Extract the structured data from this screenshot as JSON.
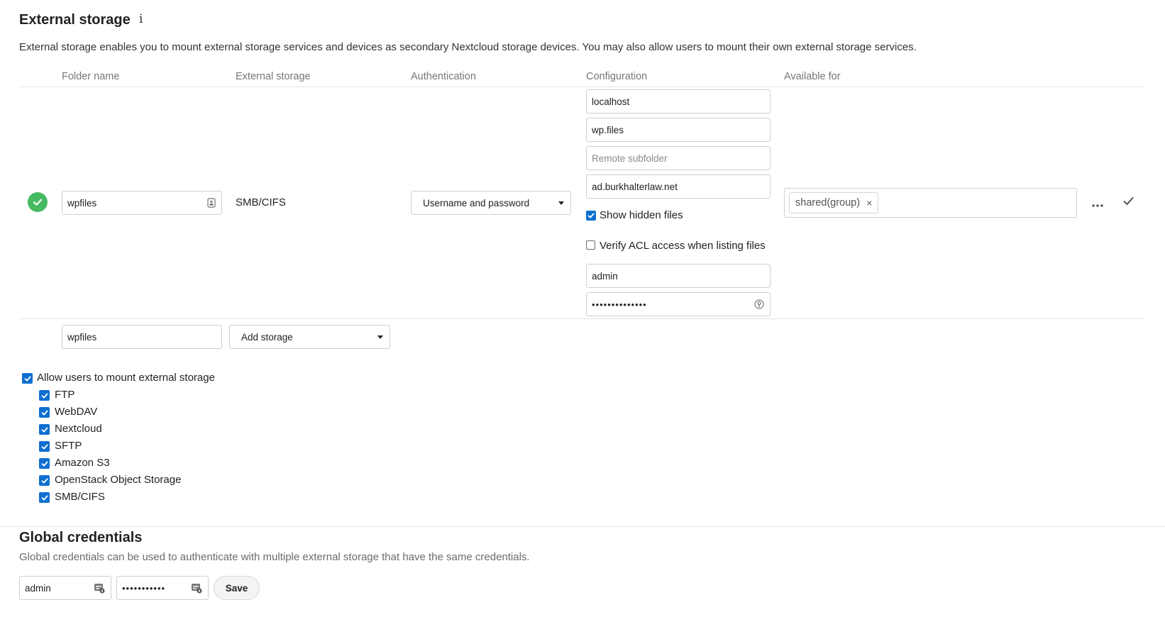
{
  "external_storage": {
    "title": "External storage",
    "info_glyph": "i",
    "description": "External storage enables you to mount external storage services and devices as secondary Nextcloud storage devices. You may also allow users to mount their own external storage services.",
    "columns": {
      "folder_name": "Folder name",
      "external_storage": "External storage",
      "authentication": "Authentication",
      "configuration": "Configuration",
      "available_for": "Available for"
    },
    "mount": {
      "status_icon": "check-circle-icon",
      "status_color": "#46ba61",
      "folder_name": "wpfiles",
      "backend": "SMB/CIFS",
      "auth": "Username and password",
      "config": {
        "host": "localhost",
        "share": "wp.files",
        "remote_subfolder_placeholder": "Remote subfolder",
        "domain": "ad.burkhalterlaw.net",
        "show_hidden_label": "Show hidden files",
        "show_hidden": true,
        "verify_acl_label": "Verify ACL access when listing files",
        "verify_acl": false,
        "user": "admin",
        "password_mask": "••••••••••••••"
      },
      "available_for": [
        "shared(group)"
      ],
      "tag_remove": "×"
    },
    "new_mount": {
      "folder_name": "wpfiles",
      "add_storage_label": "Add storage"
    },
    "allow_user_mounts": {
      "label": "Allow users to mount external storage",
      "checked": true,
      "backends": [
        {
          "label": "FTP",
          "checked": true
        },
        {
          "label": "WebDAV",
          "checked": true
        },
        {
          "label": "Nextcloud",
          "checked": true
        },
        {
          "label": "SFTP",
          "checked": true
        },
        {
          "label": "Amazon S3",
          "checked": true
        },
        {
          "label": "OpenStack Object Storage",
          "checked": true
        },
        {
          "label": "SMB/CIFS",
          "checked": true
        }
      ]
    }
  },
  "global_credentials": {
    "title": "Global credentials",
    "description": "Global credentials can be used to authenticate with multiple external storage that have the same credentials.",
    "user": "admin",
    "password_mask": "•••••••••••",
    "save_label": "Save"
  },
  "colors": {
    "accent": "#0f6fd1",
    "success": "#46ba61",
    "border": "#cfcfcf"
  }
}
